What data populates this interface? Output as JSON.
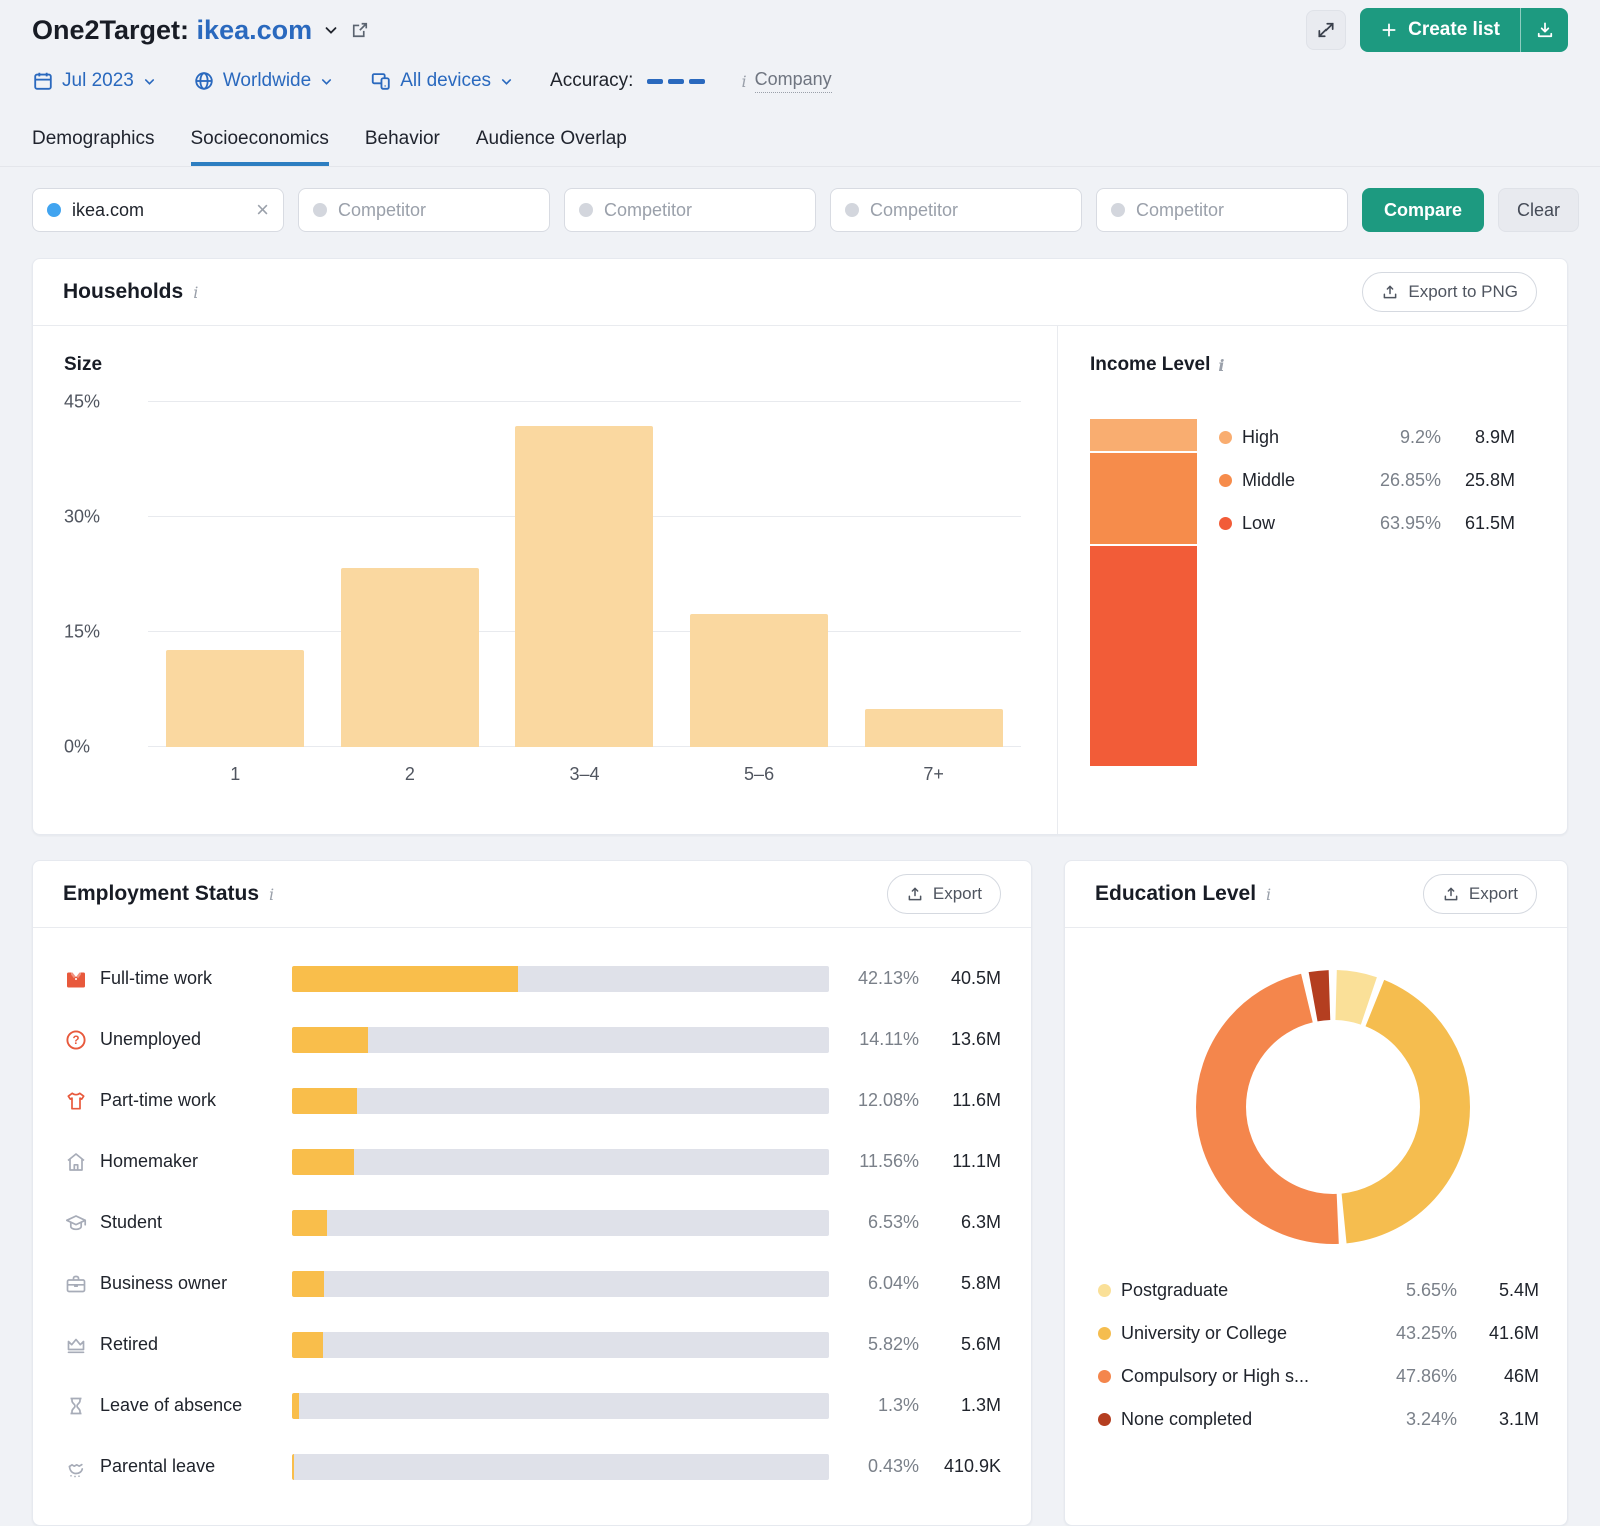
{
  "header": {
    "title_prefix": "One2Target:",
    "title_domain": "ikea.com",
    "create_list_label": "Create list",
    "filters": {
      "date": "Jul 2023",
      "region": "Worldwide",
      "devices": "All devices",
      "accuracy_label": "Accuracy:",
      "company_label": "Company"
    }
  },
  "tabs": [
    {
      "label": "Demographics",
      "active": false
    },
    {
      "label": "Socioeconomics",
      "active": true
    },
    {
      "label": "Behavior",
      "active": false
    },
    {
      "label": "Audience Overlap",
      "active": false
    }
  ],
  "competitor_bar": {
    "selected_domain": "ikea.com",
    "competitors": [
      {
        "placeholder": "Competitor"
      },
      {
        "placeholder": "Competitor"
      },
      {
        "placeholder": "Competitor"
      },
      {
        "placeholder": "Competitor"
      }
    ],
    "compare_label": "Compare",
    "clear_label": "Clear"
  },
  "households_card": {
    "title": "Households",
    "export_label": "Export to PNG"
  },
  "employment_card": {
    "title": "Employment Status",
    "export_label": "Export"
  },
  "education_card": {
    "title": "Education Level",
    "export_label": "Export"
  },
  "chart_data": [
    {
      "id": "household-size",
      "type": "bar",
      "title": "Size",
      "categories": [
        "1",
        "2",
        "3–4",
        "5–6",
        "7+"
      ],
      "values": [
        12.7,
        23.3,
        41.9,
        17.3,
        4.9
      ],
      "ylabel": "",
      "xlabel": "",
      "ylim": [
        0,
        45
      ],
      "yticks": [
        "0%",
        "15%",
        "30%",
        "45%"
      ],
      "grid": true,
      "bar_color": "#FAD8A0"
    },
    {
      "id": "income-level",
      "type": "stacked-bar",
      "title": "Income Level",
      "segments": [
        {
          "label": "High",
          "pct": 9.2,
          "pct_label": "9.2%",
          "value": "8.9M",
          "color": "#F9AD70"
        },
        {
          "label": "Middle",
          "pct": 26.85,
          "pct_label": "26.85%",
          "value": "25.8M",
          "color": "#F68C4B"
        },
        {
          "label": "Low",
          "pct": 63.95,
          "pct_label": "63.95%",
          "value": "61.5M",
          "color": "#F25C38"
        }
      ],
      "legend_position": "right"
    },
    {
      "id": "employment-status",
      "type": "hbar",
      "title": "Employment Status",
      "fill_color": "#F9BE4B",
      "track_color": "#DFE1E9",
      "rows": [
        {
          "icon": "fulltime-work-icon",
          "icon_color": "#E8593C",
          "label": "Full-time work",
          "pct": 42.13,
          "pct_label": "42.13%",
          "value": "40.5M"
        },
        {
          "icon": "unemployed-icon",
          "icon_color": "#E8593C",
          "label": "Unemployed",
          "pct": 14.11,
          "pct_label": "14.11%",
          "value": "13.6M"
        },
        {
          "icon": "parttime-work-icon",
          "icon_color": "#E8593C",
          "label": "Part-time work",
          "pct": 12.08,
          "pct_label": "12.08%",
          "value": "11.6M"
        },
        {
          "icon": "homemaker-icon",
          "icon_color": "#A7ACB8",
          "label": "Homemaker",
          "pct": 11.56,
          "pct_label": "11.56%",
          "value": "11.1M"
        },
        {
          "icon": "student-icon",
          "icon_color": "#A7ACB8",
          "label": "Student",
          "pct": 6.53,
          "pct_label": "6.53%",
          "value": "6.3M"
        },
        {
          "icon": "business-owner-icon",
          "icon_color": "#A7ACB8",
          "label": "Business owner",
          "pct": 6.04,
          "pct_label": "6.04%",
          "value": "5.8M"
        },
        {
          "icon": "retired-icon",
          "icon_color": "#A7ACB8",
          "label": "Retired",
          "pct": 5.82,
          "pct_label": "5.82%",
          "value": "5.6M"
        },
        {
          "icon": "leave-of-absence-icon",
          "icon_color": "#A7ACB8",
          "label": "Leave of absence",
          "pct": 1.3,
          "pct_label": "1.3%",
          "value": "1.3M"
        },
        {
          "icon": "parental-leave-icon",
          "icon_color": "#A7ACB8",
          "label": "Parental leave",
          "pct": 0.43,
          "pct_label": "0.43%",
          "value": "410.9K"
        }
      ]
    },
    {
      "id": "education-level",
      "type": "donut",
      "title": "Education Level",
      "slices": [
        {
          "label": "Postgraduate",
          "pct": 5.65,
          "pct_label": "5.65%",
          "value": "5.4M",
          "color": "#FAE098"
        },
        {
          "label": "University or College",
          "pct": 43.25,
          "pct_label": "43.25%",
          "value": "41.6M",
          "color": "#F5BD4F"
        },
        {
          "label": "Compulsory or High s...",
          "pct": 47.86,
          "pct_label": "47.86%",
          "value": "46M",
          "color": "#F4864C"
        },
        {
          "label": "None completed",
          "pct": 3.24,
          "pct_label": "3.24%",
          "value": "3.1M",
          "color": "#B43E20"
        }
      ],
      "legend_position": "bottom"
    }
  ]
}
